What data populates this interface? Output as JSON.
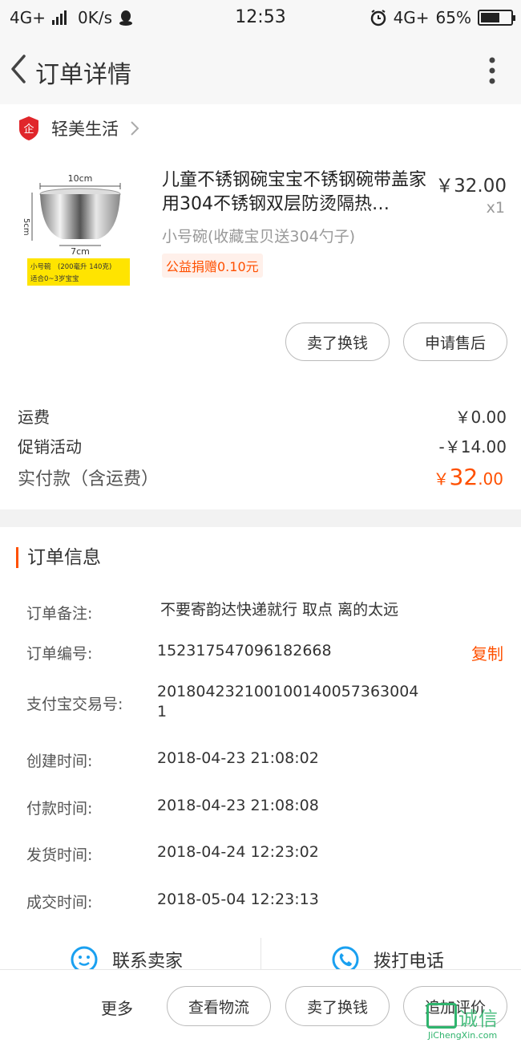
{
  "status_bar": {
    "network": "4G+",
    "speed": "0K/s",
    "time": "12:53",
    "network_right": "4G+",
    "battery": "65%",
    "battery_level": 0.65
  },
  "nav": {
    "title": "订单详情",
    "back_icon": "chevron-left-icon",
    "more_icon": "more-vertical-icon"
  },
  "shop": {
    "name": "轻美生活",
    "logo_text": "企"
  },
  "product": {
    "title": "儿童不锈钢碗宝宝不锈钢碗带盖家用304不锈钢双层防烫隔热…",
    "price": "￥32.00",
    "qty": "x1",
    "spec": "小号碗(收藏宝贝送304勺子)",
    "charity": "公益捐赠0.10元",
    "image": {
      "top_dim": "10cm",
      "side_dim": "5cm",
      "bottom_dim": "7cm",
      "caption_line1": "小号碗　(200毫升 140克)",
      "caption_line2": "适合0~3岁宝宝"
    }
  },
  "item_buttons": {
    "sell": "卖了换钱",
    "aftersale": "申请售后"
  },
  "fees": {
    "shipping_label": "运费",
    "shipping_value": "￥0.00",
    "promo_label": "促销活动",
    "promo_value": "-￥14.00",
    "total_label": "实付款（含运费）",
    "total_currency": "￥",
    "total_int": "32",
    "total_dec": ".00"
  },
  "order_info": {
    "section_title": "订单信息",
    "copy_label": "复制",
    "rows": [
      {
        "label": "订单备注:",
        "value": "不要寄韵达快递就行 取点 离的太远"
      },
      {
        "label": "订单编号:",
        "value": "152317547096182668"
      },
      {
        "label": "支付宝交易号:",
        "value": "2018042321001001400573630041"
      },
      {
        "label": "创建时间:",
        "value": "2018-04-23 21:08:02"
      },
      {
        "label": "付款时间:",
        "value": "2018-04-23 21:08:08"
      },
      {
        "label": "发货时间:",
        "value": "2018-04-24 12:23:02"
      },
      {
        "label": "成交时间:",
        "value": "2018-05-04 12:23:13"
      }
    ],
    "trade_no_line1": "201804232100100140057363004",
    "trade_no_line2": "1"
  },
  "contact": {
    "seller_label": "联系卖家",
    "seller_icon": "chat-bubble-icon",
    "phone_label": "拨打电话",
    "phone_icon": "phone-icon"
  },
  "bottom_bar": {
    "more": "更多",
    "logistics": "查看物流",
    "sell": "卖了换钱",
    "review": "追加评价"
  },
  "watermark": {
    "text": "诚信",
    "sub": "JiChengXin.com"
  },
  "colors": {
    "accent": "#ff5000",
    "contact_icon": "#1aa0f0"
  }
}
